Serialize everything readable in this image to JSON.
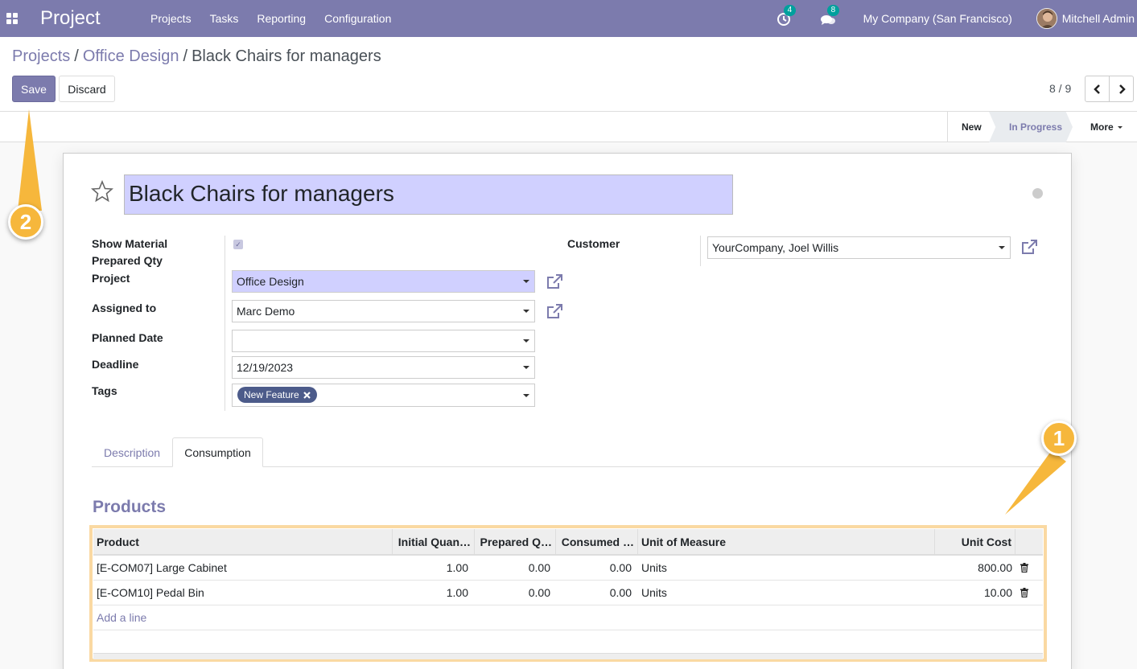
{
  "navbar": {
    "app_name": "Project",
    "menu": [
      "Projects",
      "Tasks",
      "Reporting",
      "Configuration"
    ],
    "activity_count": "4",
    "message_count": "8",
    "company": "My Company (San Francisco)",
    "user": "Mitchell Admin"
  },
  "breadcrumb": {
    "items": [
      "Projects",
      "Office Design"
    ],
    "current": "Black Chairs for managers",
    "separator": "/"
  },
  "buttons": {
    "save": "Save",
    "discard": "Discard"
  },
  "pager": {
    "value": "8 / 9"
  },
  "statusbar": {
    "stages": [
      "New",
      "In Progress"
    ],
    "active_stage": "In Progress",
    "more": "More"
  },
  "form": {
    "title": "Black Chairs for managers",
    "labels": {
      "show_material": "Show Material",
      "prepared_qty": "Prepared Qty",
      "project": "Project",
      "assigned_to": "Assigned to",
      "planned_date": "Planned Date",
      "deadline": "Deadline",
      "tags": "Tags",
      "customer": "Customer"
    },
    "values": {
      "project": "Office Design",
      "assigned_to": "Marc Demo",
      "planned_date": "",
      "deadline": "12/19/2023",
      "tag": "New Feature",
      "customer": "YourCompany, Joel Willis",
      "checkbox_glyph": "✓"
    }
  },
  "tabs": [
    "Description",
    "Consumption"
  ],
  "active_tab": "Consumption",
  "products": {
    "title": "Products",
    "columns": [
      "Product",
      "Initial Quan…",
      "Prepared Q…",
      "Consumed …",
      "Unit of Measure",
      "Unit Cost"
    ],
    "rows": [
      {
        "product": "[E-COM07] Large Cabinet",
        "initial": "1.00",
        "prepared": "0.00",
        "consumed": "0.00",
        "uom": "Units",
        "cost": "800.00"
      },
      {
        "product": "[E-COM10] Pedal Bin",
        "initial": "1.00",
        "prepared": "0.00",
        "consumed": "0.00",
        "uom": "Units",
        "cost": "10.00"
      }
    ],
    "add_line": "Add a line"
  },
  "callouts": [
    "1",
    "2"
  ],
  "colors": {
    "brand": "#7c7bad",
    "callout": "#f6b73c",
    "highlight_border": "#fad9a2",
    "required_field": "#d0d0ff",
    "tag": "#4c5b8a"
  }
}
